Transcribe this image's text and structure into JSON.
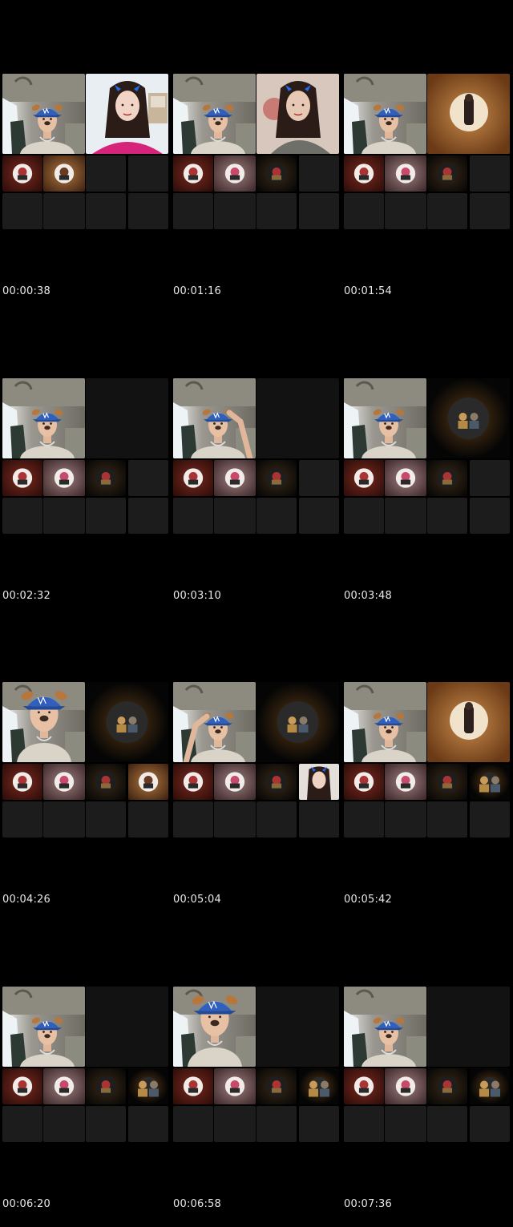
{
  "frames": [
    {
      "timestamp": "00:00:38",
      "variant": "A1"
    },
    {
      "timestamp": "00:01:16",
      "variant": "A2"
    },
    {
      "timestamp": "00:01:54",
      "variant": "A3"
    },
    {
      "timestamp": "00:02:32",
      "variant": "B1"
    },
    {
      "timestamp": "00:03:10",
      "variant": "B2"
    },
    {
      "timestamp": "00:03:48",
      "variant": "B3"
    },
    {
      "timestamp": "00:04:26",
      "variant": "C1"
    },
    {
      "timestamp": "00:05:04",
      "variant": "C2"
    },
    {
      "timestamp": "00:05:42",
      "variant": "C3"
    },
    {
      "timestamp": "00:06:20",
      "variant": "D1"
    },
    {
      "timestamp": "00:06:58",
      "variant": "D2"
    },
    {
      "timestamp": "00:07:36",
      "variant": "D3"
    }
  ],
  "colors": {
    "background": "#000000",
    "empty_tile": "#1c1c1c",
    "cap_blue": "#2f5fbf",
    "timestamp_text": "#e8e8e8"
  },
  "icons": {
    "car_interior": "car-interior-thumbnail",
    "avatar": "avatar-circle",
    "dog_filter": "dog-ears-filter-icon",
    "devil_horns": "devil-horns-filter-icon"
  }
}
